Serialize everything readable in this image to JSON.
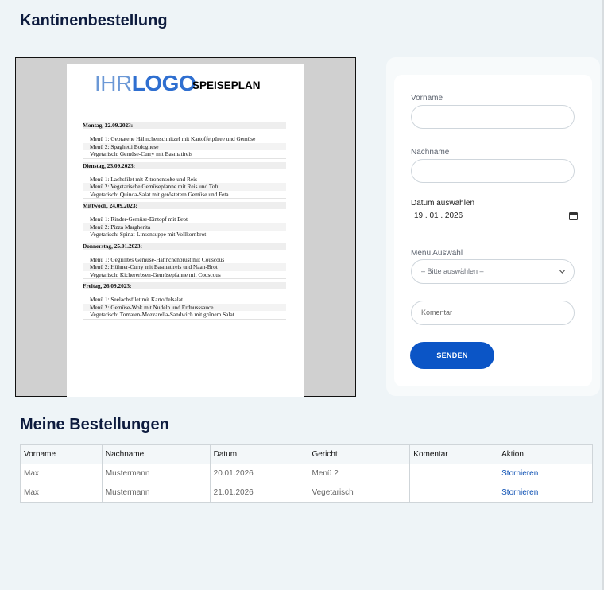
{
  "page": {
    "title": "Kantinenbestellung"
  },
  "menu_document": {
    "logo_part1": "IHR",
    "logo_part2": "LOGO",
    "title": "SPEISEPLAN",
    "days": [
      {
        "heading": "Montag, 22.09.2023:",
        "items": [
          "Menü 1: Gebratene Hähnchenschnitzel mit Kartoffelpüree und Gemüse",
          "Menü 2: Spaghetti Bolognese",
          "Vegetarisch: Gemüse-Curry mit Basmatireis"
        ]
      },
      {
        "heading": "Dienstag, 23.09.2023:",
        "items": [
          "Menü 1: Lachsfilet mit Zitronensoße und Reis",
          "Menü 2: Vegetarische Gemüsepfanne mit Reis und Tofu",
          "Vegetarisch: Quinoa-Salat mit geröstetem Gemüse und Feta"
        ]
      },
      {
        "heading": "Mittwoch, 24.09.2023:",
        "items": [
          "Menü 1: Rinder-Gemüse-Eintopf mit Brot",
          "Menü 2: Pizza Margherita",
          "Vegetarisch: Spinat-Linsensuppe mit Vollkornbrot"
        ]
      },
      {
        "heading": "Donnerstag, 25.01.2023:",
        "items": [
          "Menü 1: Gegrilltes Gemüse-Hähnchenbrust mit Couscous",
          "Menü 2: Hühner-Curry mit Basmatireis und Naan-Brot",
          "Vegetarisch: Kichererbsen-Gemüsepfanne mit Couscous"
        ]
      },
      {
        "heading": "Freitag, 26.09.2023:",
        "items": [
          "Menü 1: Seelachsfilet mit Kartoffelsalat",
          "Menü 2: Gemüse-Wok mit Nudeln und Erdnusssauce",
          "Vegetarisch: Tomaten-Mozzarella-Sandwich mit grünem Salat"
        ]
      }
    ]
  },
  "form": {
    "vorname_label": "Vorname",
    "vorname_value": "",
    "nachname_label": "Nachname",
    "nachname_value": "",
    "date_label": "Datum auswählen",
    "date_value": "19 . 01 . 2026",
    "menu_label": "Menü Auswahl",
    "menu_selected": "– Bitte auswählen –",
    "comment_placeholder": "Komentar",
    "send_label": "SENDEN",
    "icons": {
      "date": "calendar-icon",
      "select": "chevron-down-icon"
    }
  },
  "orders": {
    "title": "Meine Bestellungen",
    "headers": [
      "Vorname",
      "Nachname",
      "Datum",
      "Gericht",
      "Komentar",
      "Aktion"
    ],
    "rows": [
      {
        "vorname": "Max",
        "nachname": "Mustermann",
        "datum": "20.01.2026",
        "gericht": "Menü 2",
        "komentar": "",
        "aktion": "Stornieren"
      },
      {
        "vorname": "Max",
        "nachname": "Mustermann",
        "datum": "21.01.2026",
        "gericht": "Vegetarisch",
        "komentar": "",
        "aktion": "Stornieren"
      }
    ]
  },
  "colors": {
    "accent": "#0b55c6",
    "link": "#0b4fb3",
    "heading": "#0d1b3e",
    "background": "#eef4f7"
  }
}
